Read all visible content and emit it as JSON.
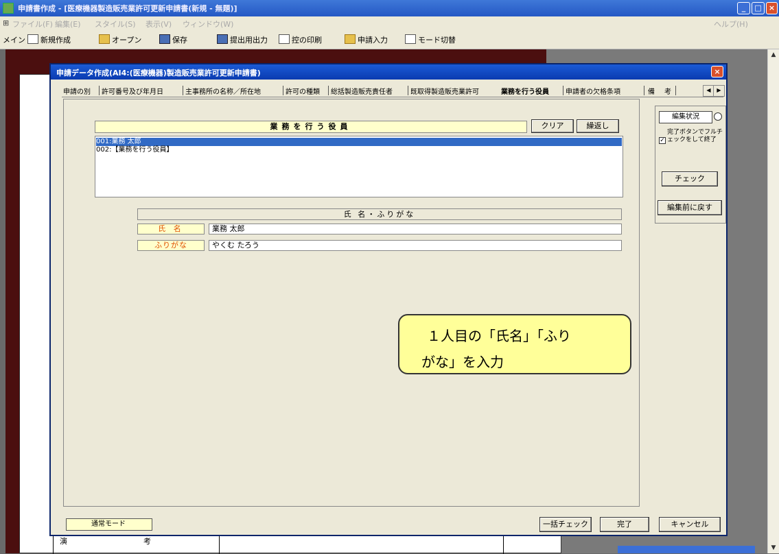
{
  "window": {
    "title": "申請書作成 - [医療機器製造販売業許可更新申請書(新規 - 無題)]",
    "min": "_",
    "max": "□",
    "close": "×"
  },
  "menu": {
    "items": [
      "ファイル(F)",
      "編集(E)",
      "スタイル(S)",
      "表示(V)",
      "ウィンドウ(W)"
    ],
    "help": "ヘルプ(H)"
  },
  "toolbar": {
    "main": "メイン",
    "new": "新規作成",
    "open": "オープン",
    "save": "保存",
    "export": "提出用出力",
    "print": "控の印刷",
    "import": "申請入力",
    "mode": "モード切替"
  },
  "dialog": {
    "title": "申請データ作成(AI4:(医療機器)製造販売業許可更新申請書)",
    "close": "×",
    "tabs": [
      "申請の別",
      "許可番号及び年月日",
      "主事務所の名称／所在地",
      "許可の種類",
      "総括製造販売責任者",
      "既取得製造販売業許可",
      "業務を行う役員",
      "申請者の欠格条項",
      "備",
      "考"
    ],
    "section_title": "業務を行う役員",
    "clear_btn": "クリア",
    "renumber_btn": "繰返し",
    "list": [
      "001:業務 太郎",
      "002:【業務を行う役員】"
    ],
    "sub_header": "氏 名・ふりがな",
    "name_label": "氏 名",
    "name_value": "業務 太郎",
    "kana_label": "ふりがな",
    "kana_value": "やくむ たろう",
    "edit_status_label": "編集状況",
    "edit_status_value": "○",
    "check_text": "完了ボタンでフルチェックをして終了",
    "check_btn": "チェック",
    "revert_btn": "編集前に戻す",
    "mode_label": "通常モード",
    "bulk_check_btn": "一括チェック",
    "done_btn": "完了",
    "cancel_btn": "キャンセル"
  },
  "callout": {
    "line1": "１人目の「氏名」「ふり",
    "line2": "がな」を入力"
  },
  "doc_bg": {
    "chars": [
      "演",
      "考"
    ]
  }
}
